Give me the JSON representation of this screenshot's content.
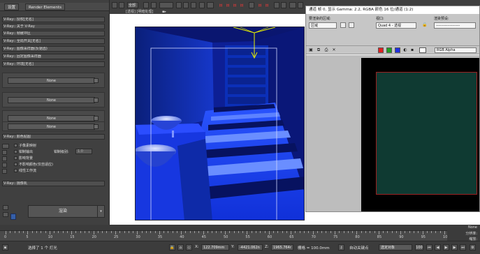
{
  "topbar": {
    "dropdown_value": "全部",
    "viewport_label": "[透视] [明暗处理]"
  },
  "left_panel": {
    "tabs": [
      {
        "label": "设置"
      },
      {
        "label": "Render Elements"
      }
    ],
    "rollouts": [
      {
        "label": "V-Ray:: 授权[无名]"
      },
      {
        "label": "V-Ray:: 关于 V-Ray"
      },
      {
        "label": "V-Ray:: 帧缓冲区"
      },
      {
        "label": "V-Ray:: 全局开关[无名]"
      },
      {
        "label": "V-Ray:: 图像采样器(反锯齿)"
      },
      {
        "label": "V-Ray:: 固定图像采样器"
      },
      {
        "label": "V-Ray:: 环境[无名]"
      }
    ],
    "env_slots": [
      {
        "map": "None"
      },
      {
        "map": "None"
      },
      {
        "map": "None"
      },
      {
        "map": "None"
      }
    ],
    "color_mapping": {
      "header": "V-Ray:: 颜色贴图",
      "options": [
        {
          "label": "子像素映射"
        },
        {
          "label": "钳制输出"
        },
        {
          "label": "影响背景"
        },
        {
          "label": "不影响颜色(仅自适应)"
        },
        {
          "label": "线性工作流"
        }
      ],
      "clamp_label": "钳制级别:",
      "clamp_value": "1.0"
    },
    "camera_rollout": "V-Ray:: 摄像机",
    "render_button": "渲染"
  },
  "frame_buffer": {
    "title": "通道 帧 0, 显示 Gamma: 2.2, RGBA 颜色 16 位/通道 (1:2)",
    "area_label": "要渲染的区域:",
    "area_value": "区域",
    "viewport_label": "视口:",
    "viewport_value": "Quad 4 - 透视",
    "preset_label": "渲染预设:",
    "preset_value": "-------------------",
    "channel_value": "RGB Alpha",
    "swatch_colors": [
      "#e02020",
      "#20a020",
      "#2030e0",
      "#ffffff"
    ]
  },
  "timeline": {
    "ticks": [
      {
        "v": "0"
      },
      {
        "v": "5"
      },
      {
        "v": "10"
      },
      {
        "v": "15"
      },
      {
        "v": "20"
      },
      {
        "v": "25"
      },
      {
        "v": "30"
      },
      {
        "v": "35"
      },
      {
        "v": "40"
      },
      {
        "v": "45"
      },
      {
        "v": "50"
      },
      {
        "v": "55"
      },
      {
        "v": "60"
      },
      {
        "v": "65"
      },
      {
        "v": "70"
      },
      {
        "v": "75"
      },
      {
        "v": "80"
      },
      {
        "v": "85"
      },
      {
        "v": "90"
      },
      {
        "v": "95"
      },
      {
        "v": "100"
      }
    ],
    "right_labels": [
      "None",
      "分辨率:",
      "缩放:"
    ]
  },
  "status": {
    "selection": "选择了 1 个 灯光",
    "x_label": "X:",
    "x_value": "122.709mm",
    "y_label": "Y:",
    "y_value": "-4421.062n",
    "z_label": "Z:",
    "z_value": "1965.764r",
    "grid": "栅格 = 100.0mm",
    "autokey": "自动关键点",
    "selected_mode": "选定对象",
    "frame_value": "100"
  }
}
